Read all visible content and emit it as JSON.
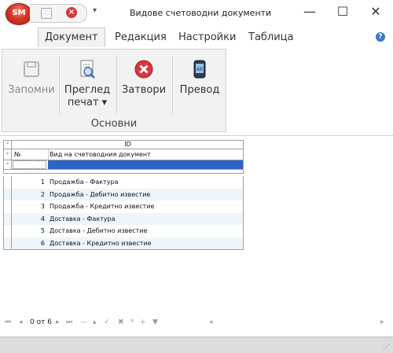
{
  "window": {
    "title": "Видове счетоводни документи",
    "orb_label": "SM",
    "minimize": "—",
    "maximize": "☐",
    "close": "✕",
    "qat_dropdown": "▾"
  },
  "tabs": [
    {
      "label": "Документ",
      "active": true
    },
    {
      "label": "Редакция"
    },
    {
      "label": "Настройки"
    },
    {
      "label": "Таблица"
    }
  ],
  "help": "?",
  "ribbon": {
    "group_label": "Основни",
    "buttons": [
      {
        "line1": "Запомни",
        "line2": "",
        "icon": "save-icon",
        "enabled": false
      },
      {
        "line1": "Преглед",
        "line2": "печат ▾",
        "icon": "print-preview-icon",
        "enabled": true
      },
      {
        "line1": "Затвори",
        "line2": "",
        "icon": "close-icon",
        "enabled": true
      },
      {
        "line1": "Превод",
        "line2": "",
        "icon": "translate-icon",
        "enabled": true
      }
    ]
  },
  "grid": {
    "header_id": "ID",
    "col_num": "№",
    "col_name": "Вид на счетоводния документ",
    "indicator": "*",
    "rows": [
      {
        "num": "1",
        "name": "Продажба - Фактура"
      },
      {
        "num": "2",
        "name": "Продажба - Дебитно известие"
      },
      {
        "num": "3",
        "name": "Продажба - Кредитно известие"
      },
      {
        "num": "4",
        "name": "Доставка - Фактура"
      },
      {
        "num": "5",
        "name": "Доставка - Дебитно известие"
      },
      {
        "num": "6",
        "name": "Доставка - Кредитно известие"
      }
    ]
  },
  "navigator": {
    "first": "⏮",
    "prev": "◂",
    "record_text": "0 от 6",
    "next": "▸",
    "last": "⏭",
    "add": "+",
    "delete": "—",
    "up": "▴",
    "edit": "✓",
    "cancel": "✖",
    "star": "*",
    "filter": "▼",
    "scroll_left": "◂",
    "scroll_right": "▸"
  },
  "status": {
    "grip": "⋰"
  }
}
